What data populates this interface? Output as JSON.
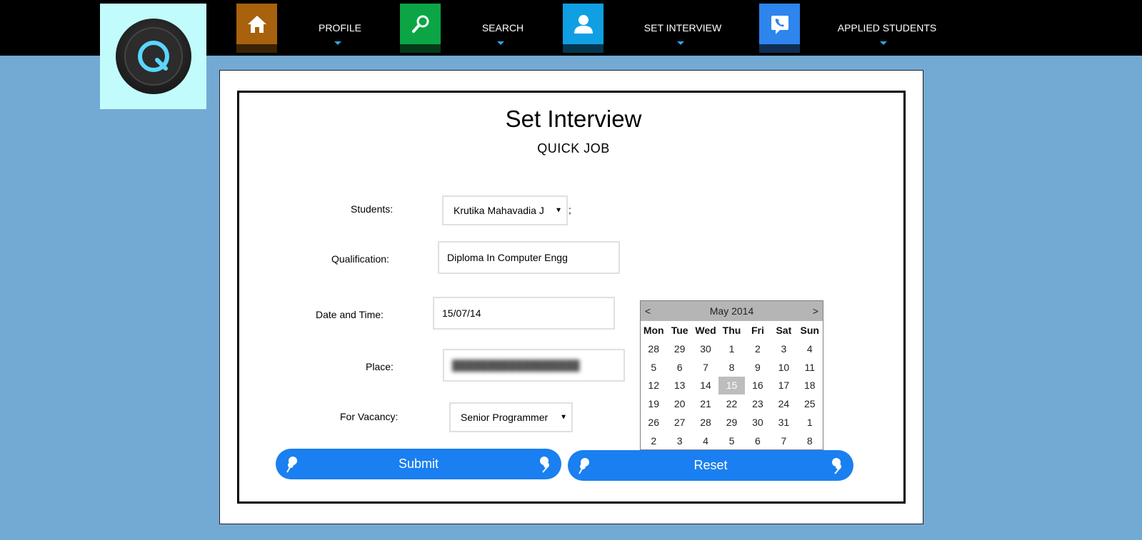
{
  "nav": {
    "items": [
      {
        "label": "PROFILE",
        "icon": "home-icon",
        "color": "#a8610c"
      },
      {
        "label": "SEARCH",
        "icon": "search-icon",
        "color": "#0ba546"
      },
      {
        "label": "SET INTERVIEW",
        "icon": "user-icon",
        "color": "#109fe3"
      },
      {
        "label": "APPLIED STUDENTS",
        "icon": "phone-icon",
        "color": "#2e85ee"
      }
    ]
  },
  "logo": {
    "icon": "q-logo-icon",
    "bg": "#c2fbfb"
  },
  "form": {
    "title": "Set Interview",
    "subtitle": "QUICK JOB",
    "students_label": "Students:",
    "students_value": "Krutika Mahavadia J",
    "students_suffix": ";",
    "qualification_label": "Qualification:",
    "qualification_value": "Diploma In Computer Engg",
    "datetime_label": "Date and Time:",
    "datetime_value": "15/07/14",
    "place_label": "Place:",
    "vacancy_label": "For Vacancy:",
    "vacancy_value": "Senior Programmer",
    "submit_label": "Submit",
    "reset_label": "Reset"
  },
  "calendar": {
    "prev": "<",
    "next": ">",
    "month": "May 2014",
    "dow": [
      "Mon",
      "Tue",
      "Wed",
      "Thu",
      "Fri",
      "Sat",
      "Sun"
    ],
    "days": [
      "28",
      "29",
      "30",
      "1",
      "2",
      "3",
      "4",
      "5",
      "6",
      "7",
      "8",
      "9",
      "10",
      "11",
      "12",
      "13",
      "14",
      "15",
      "16",
      "17",
      "18",
      "19",
      "20",
      "21",
      "22",
      "23",
      "24",
      "25",
      "26",
      "27",
      "28",
      "29",
      "30",
      "31",
      "1",
      "2",
      "3",
      "4",
      "5",
      "6",
      "7",
      "8"
    ],
    "selected": "15"
  },
  "colors": {
    "accent": "#1a7ff0",
    "background": "#73aad3"
  }
}
